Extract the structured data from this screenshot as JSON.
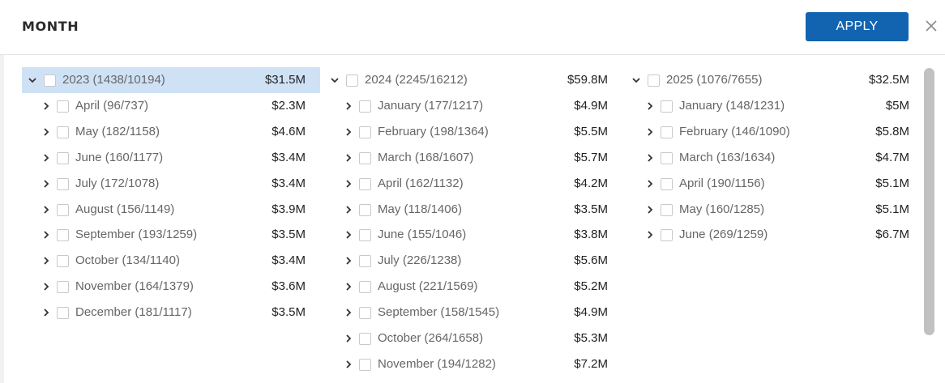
{
  "header": {
    "title": "MONTH",
    "apply_label": "APPLY"
  },
  "columns": [
    {
      "year": {
        "label": "2023 (1438/10194)",
        "amount": "$31.5M",
        "highlighted": true
      },
      "months": [
        {
          "label": "April (96/737)",
          "amount": "$2.3M"
        },
        {
          "label": "May (182/1158)",
          "amount": "$4.6M"
        },
        {
          "label": "June (160/1177)",
          "amount": "$3.4M"
        },
        {
          "label": "July (172/1078)",
          "amount": "$3.4M"
        },
        {
          "label": "August (156/1149)",
          "amount": "$3.9M"
        },
        {
          "label": "September (193/1259)",
          "amount": "$3.5M"
        },
        {
          "label": "October (134/1140)",
          "amount": "$3.4M"
        },
        {
          "label": "November (164/1379)",
          "amount": "$3.6M"
        },
        {
          "label": "December (181/1117)",
          "amount": "$3.5M"
        }
      ]
    },
    {
      "year": {
        "label": "2024 (2245/16212)",
        "amount": "$59.8M",
        "highlighted": false
      },
      "months": [
        {
          "label": "January (177/1217)",
          "amount": "$4.9M"
        },
        {
          "label": "February (198/1364)",
          "amount": "$5.5M"
        },
        {
          "label": "March (168/1607)",
          "amount": "$5.7M"
        },
        {
          "label": "April (162/1132)",
          "amount": "$4.2M"
        },
        {
          "label": "May (118/1406)",
          "amount": "$3.5M"
        },
        {
          "label": "June (155/1046)",
          "amount": "$3.8M"
        },
        {
          "label": "July (226/1238)",
          "amount": "$5.6M"
        },
        {
          "label": "August (221/1569)",
          "amount": "$5.2M"
        },
        {
          "label": "September (158/1545)",
          "amount": "$4.9M"
        },
        {
          "label": "October (264/1658)",
          "amount": "$5.3M"
        },
        {
          "label": "November (194/1282)",
          "amount": "$7.2M"
        }
      ]
    },
    {
      "year": {
        "label": "2025 (1076/7655)",
        "amount": "$32.5M",
        "highlighted": false
      },
      "months": [
        {
          "label": "January (148/1231)",
          "amount": "$5M"
        },
        {
          "label": "February (146/1090)",
          "amount": "$5.8M"
        },
        {
          "label": "March (163/1634)",
          "amount": "$4.7M"
        },
        {
          "label": "April (190/1156)",
          "amount": "$5.1M"
        },
        {
          "label": "May (160/1285)",
          "amount": "$5.1M"
        },
        {
          "label": "June (269/1259)",
          "amount": "$6.7M"
        }
      ]
    }
  ],
  "colors": {
    "apply_bg": "#1264b1",
    "highlight": "#cfe2f5",
    "scrollbar": "#c1c1c1"
  },
  "icons": {
    "close": "close-icon",
    "expand": "chevron-down-icon",
    "collapse": "chevron-right-icon"
  }
}
